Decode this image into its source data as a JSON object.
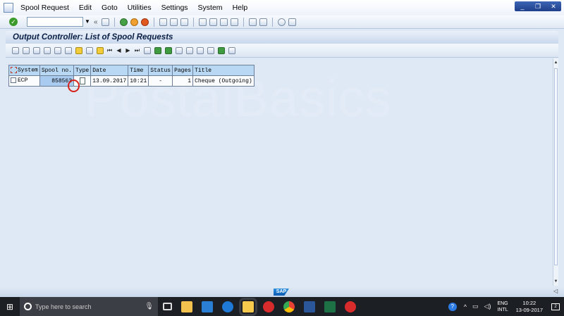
{
  "menubar": {
    "items": [
      "Spool Request",
      "Edit",
      "Goto",
      "Utilities",
      "Settings",
      "System",
      "Help"
    ]
  },
  "window_controls": [
    "minimize-icon",
    "restore-icon",
    "close-icon"
  ],
  "standard_toolbar": {
    "command_field_value": "",
    "command_glyph": "«"
  },
  "page": {
    "title": "Output Controller: List of Spool Requests"
  },
  "spool_table": {
    "columns": [
      "System",
      "Spool no.",
      "Type",
      "Date",
      "Time",
      "Status",
      "Pages",
      "Title"
    ],
    "rows": [
      {
        "system": "ECP",
        "spool_no": "858563",
        "type_icon": "document-icon",
        "date": "13.09.2017",
        "time": "10:21",
        "status": "-",
        "pages": "1",
        "title": "Cheque (Outgoing)"
      }
    ]
  },
  "watermark": "PostalBasics",
  "footer": {
    "logo": "SAP"
  },
  "taskbar": {
    "search_placeholder": "Type here to search",
    "language_top": "ENG",
    "language_bottom": "INTL",
    "time": "10:22",
    "date": "13-09-2017",
    "notification_count": "2"
  },
  "colors": {
    "accent": "#1f3f8a",
    "header_cell": "#b9d8f3",
    "highlight_cell": "#a9cbef",
    "annotation_circle": "#d6221b"
  }
}
